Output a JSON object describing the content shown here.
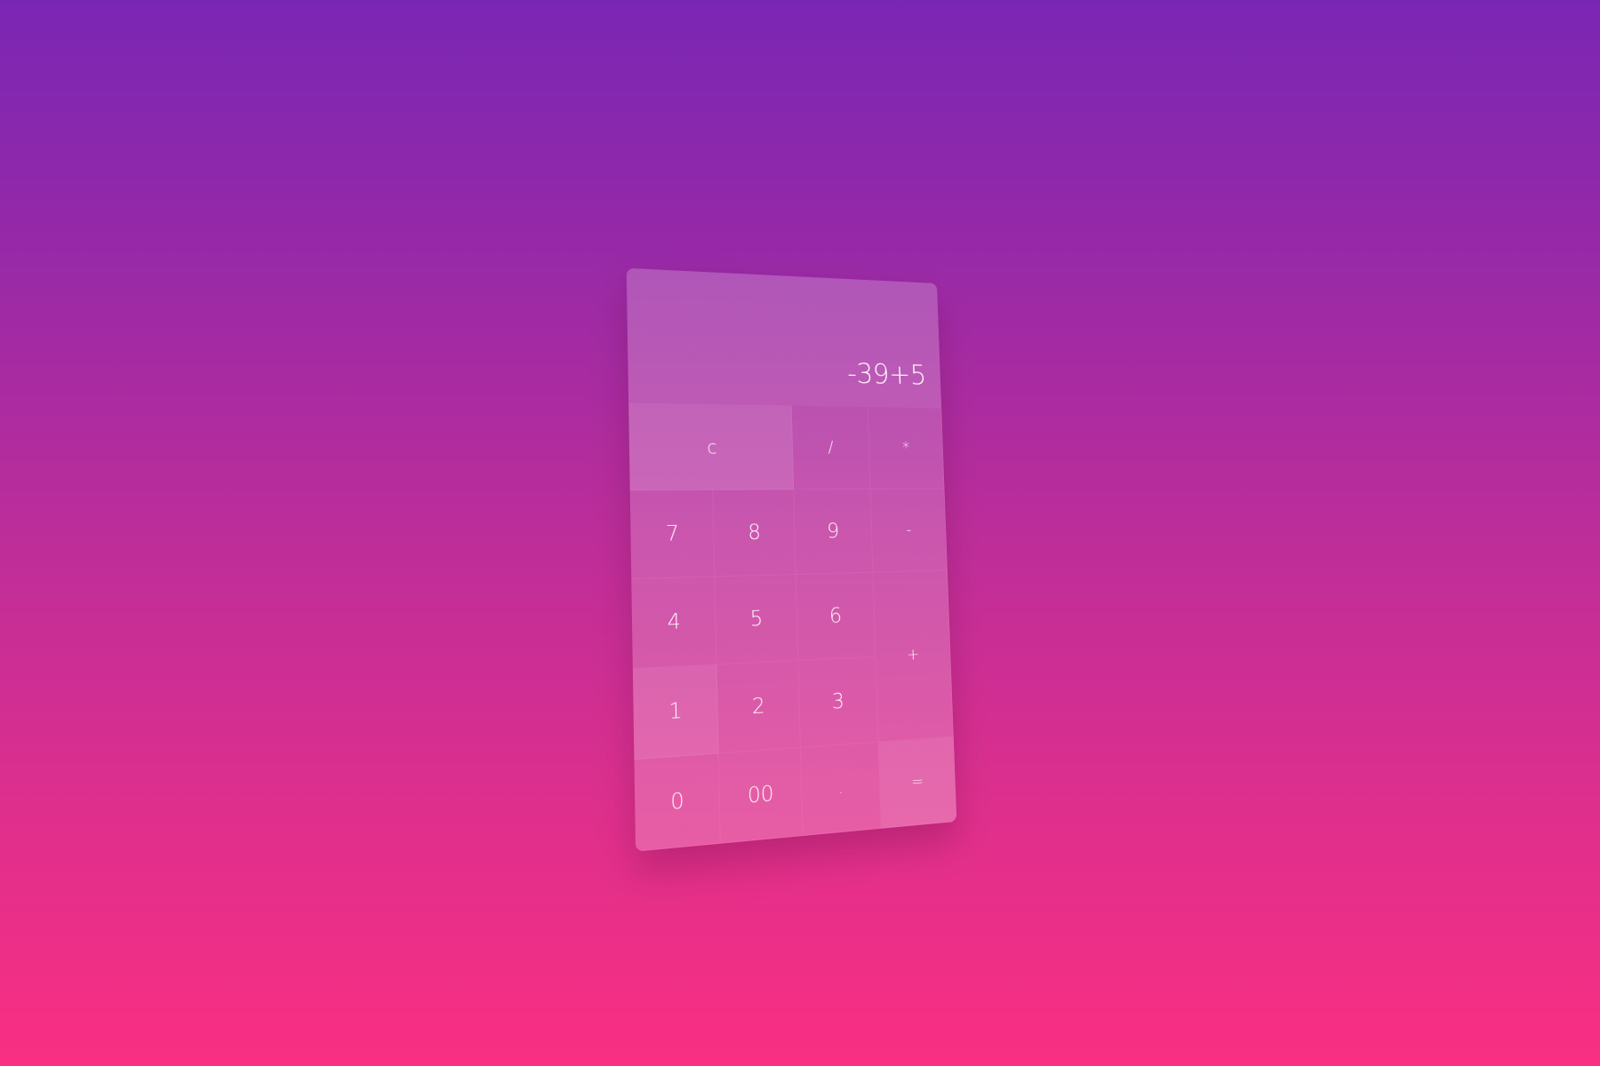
{
  "display": {
    "expression": "-39+5"
  },
  "keys": {
    "clear": "c",
    "divide": "/",
    "multiply": "*",
    "seven": "7",
    "eight": "8",
    "nine": "9",
    "minus": "-",
    "four": "4",
    "five": "5",
    "six": "6",
    "plus": "+",
    "one": "1",
    "two": "2",
    "three": "3",
    "zero": "0",
    "double_zero": "00",
    "decimal": ".",
    "equals": "="
  },
  "colors": {
    "background_top": "#7a26b4",
    "background_bottom": "#f92f82"
  }
}
